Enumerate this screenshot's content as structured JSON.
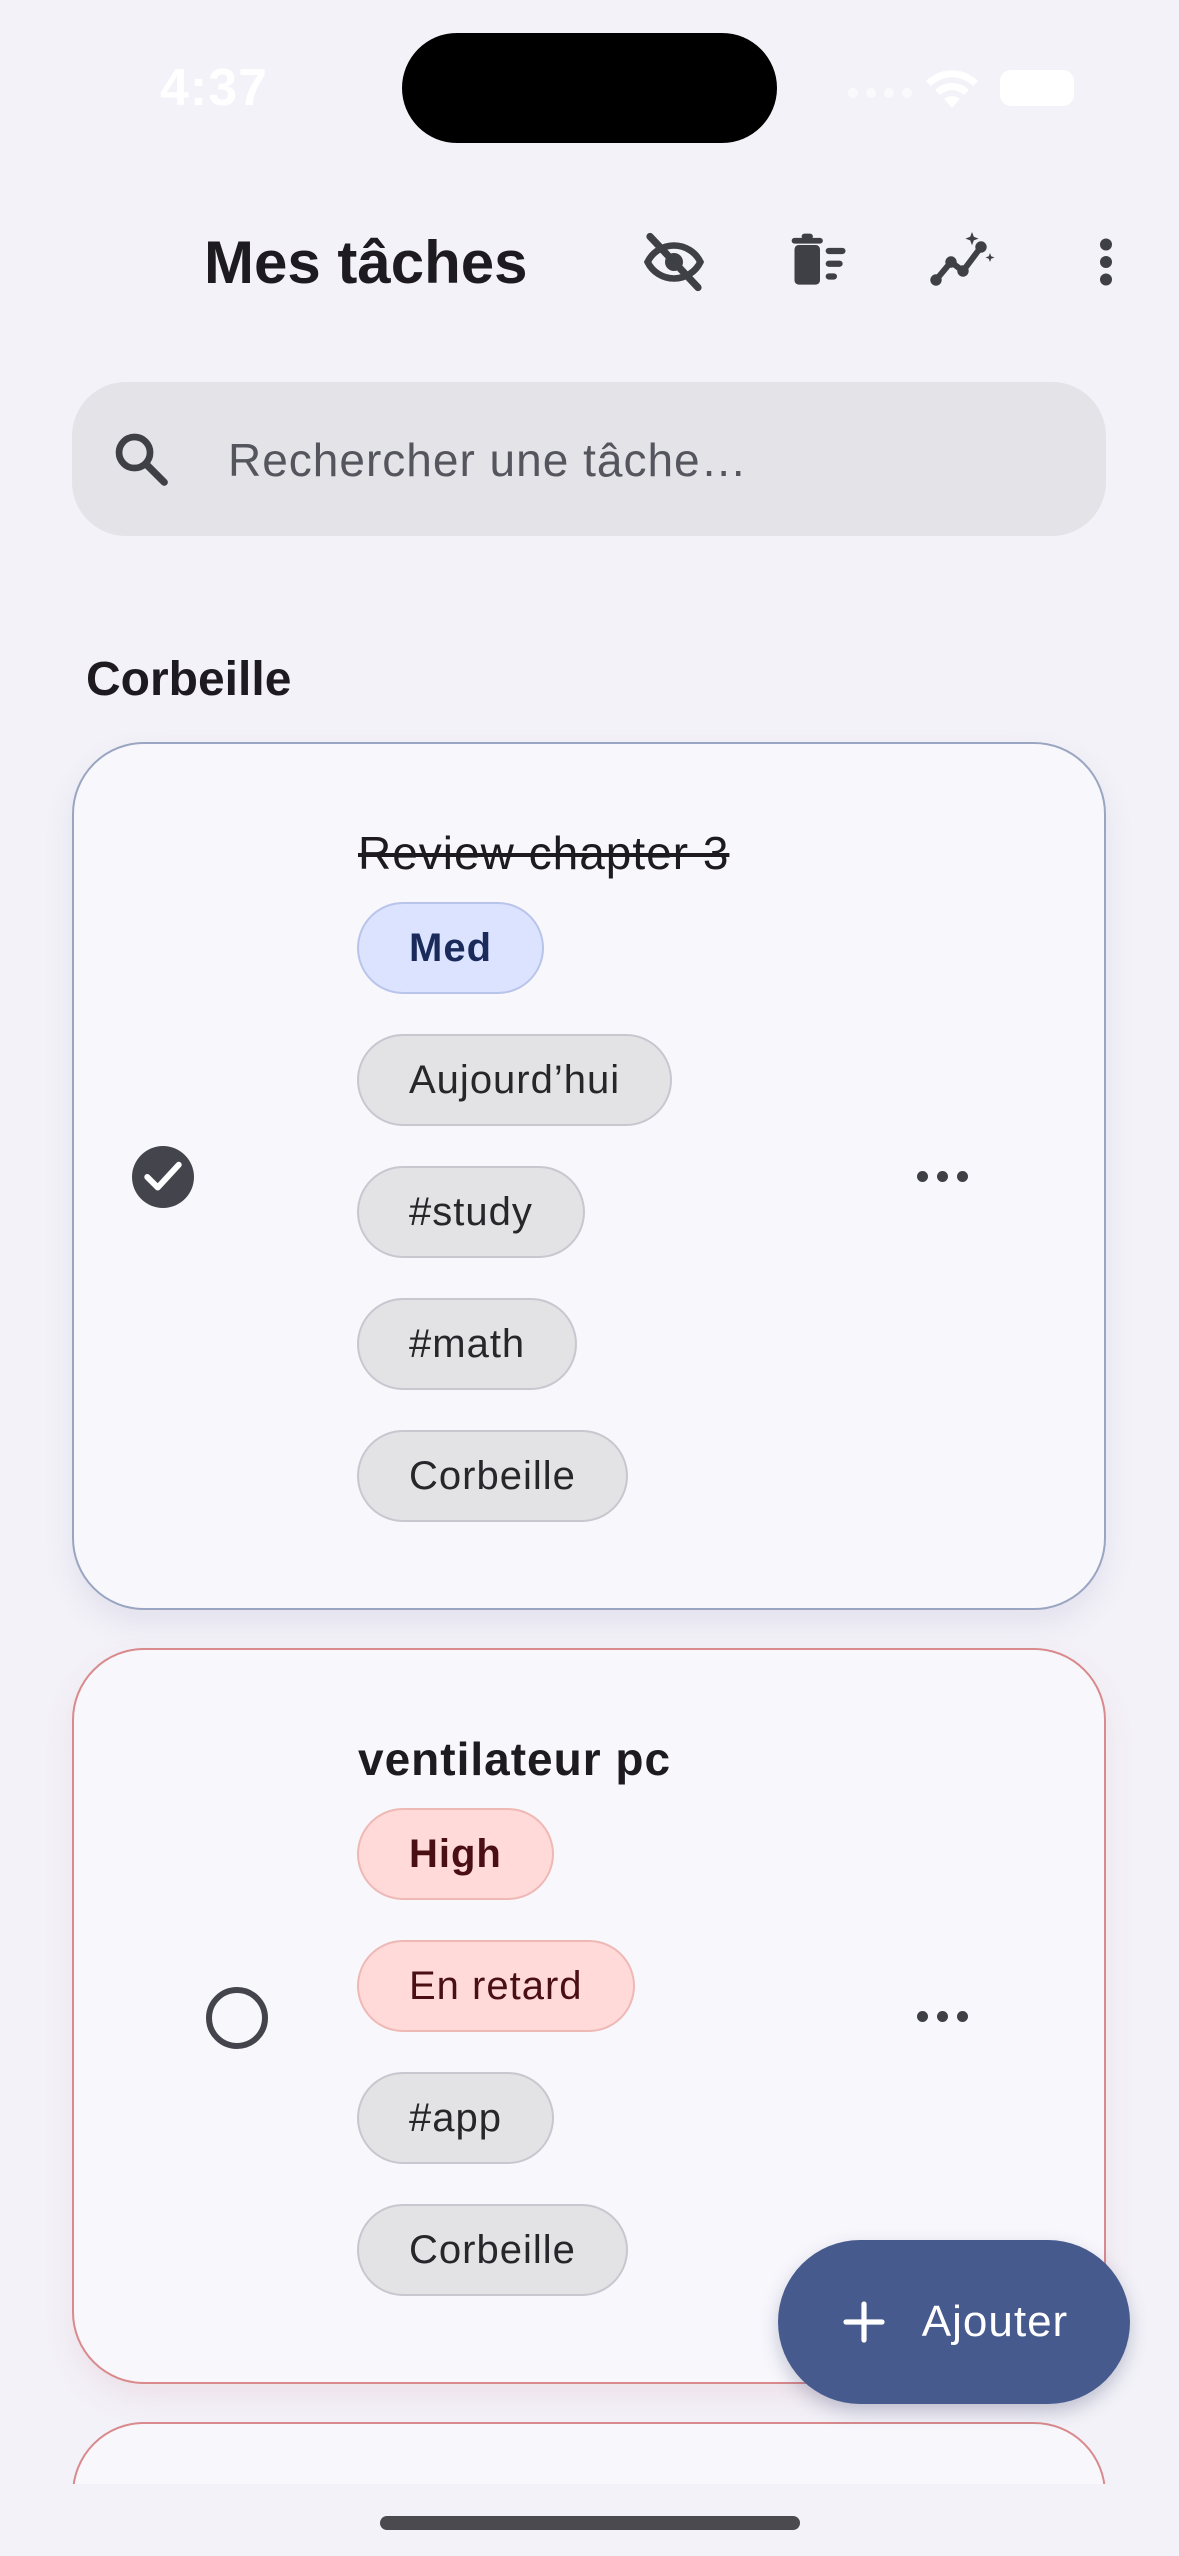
{
  "status_bar": {
    "time": "4:37"
  },
  "app_bar": {
    "title": "Mes tâches",
    "icons": [
      "eye-off-icon",
      "delete-sweep-icon",
      "insights-icon",
      "more-vert-icon"
    ]
  },
  "search": {
    "placeholder": "Rechercher une tâche…",
    "value": ""
  },
  "section": {
    "title": "Corbeille"
  },
  "tasks": [
    {
      "title": "Review chapter 3",
      "completed": true,
      "priority": "Med",
      "chips": [
        "Aujourd’hui",
        "#study",
        "#math",
        "Corbeille"
      ]
    },
    {
      "title": "ventilateur pc",
      "completed": false,
      "priority": "High",
      "chips": [
        "En retard",
        "#app",
        "Corbeille"
      ]
    }
  ],
  "fab": {
    "label": "Ajouter"
  },
  "colors": {
    "background": "#f3f2f8",
    "primary": "#475a8e",
    "med_priority": "#dbe3ff",
    "high_priority": "#ffdad8",
    "card_border_med": "#9aa5c2",
    "card_border_high": "#d88a8c"
  }
}
